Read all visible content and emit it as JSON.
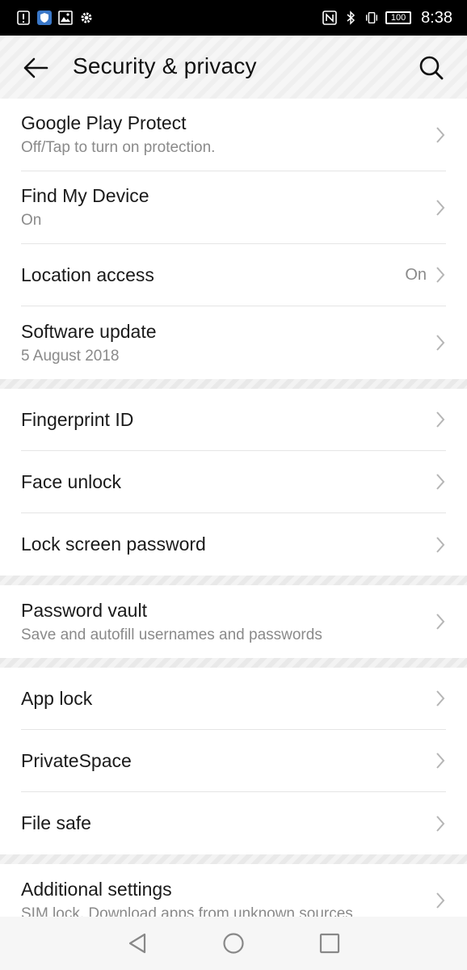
{
  "status_bar": {
    "time": "8:38",
    "battery": "100",
    "left_icons": [
      "alert-icon",
      "shield-app-icon",
      "image-icon",
      "gear-icon"
    ],
    "right_icons": [
      "nfc-icon",
      "bluetooth-icon",
      "vibrate-icon",
      "battery-icon"
    ]
  },
  "header": {
    "title": "Security & privacy"
  },
  "groups": [
    {
      "items": [
        {
          "title": "Google Play Protect",
          "subtitle": "Off/Tap to turn on protection.",
          "value": ""
        },
        {
          "title": "Find My Device",
          "subtitle": "On",
          "value": ""
        },
        {
          "title": "Location access",
          "subtitle": "",
          "value": "On"
        },
        {
          "title": "Software update",
          "subtitle": "5 August 2018",
          "value": ""
        }
      ]
    },
    {
      "items": [
        {
          "title": "Fingerprint ID"
        },
        {
          "title": "Face unlock"
        },
        {
          "title": "Lock screen password"
        }
      ]
    },
    {
      "items": [
        {
          "title": "Password vault",
          "subtitle": "Save and autofill usernames and passwords"
        }
      ]
    },
    {
      "items": [
        {
          "title": "App lock"
        },
        {
          "title": "PrivateSpace"
        },
        {
          "title": "File safe"
        }
      ]
    },
    {
      "items": [
        {
          "title": "Additional settings",
          "subtitle": "SIM lock, Download apps from unknown sources"
        }
      ]
    }
  ],
  "colors": {
    "status_bar_bg": "#000000",
    "text_primary": "#1a1a1a",
    "text_secondary": "#8a8a8a",
    "divider": "#e5e5e5"
  }
}
